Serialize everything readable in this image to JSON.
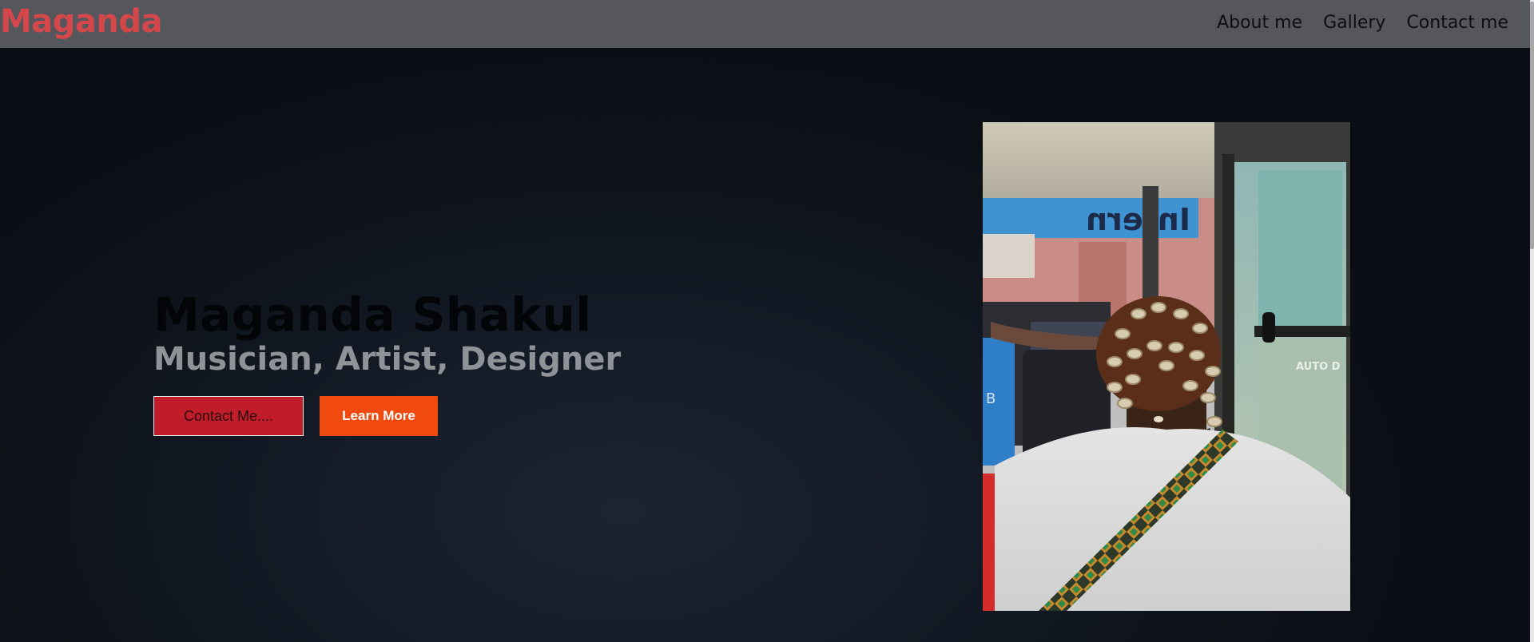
{
  "brand": {
    "name": "Maganda"
  },
  "nav": {
    "links": [
      {
        "label": "About me"
      },
      {
        "label": "Gallery"
      },
      {
        "label": "Contact me"
      }
    ]
  },
  "hero": {
    "title": "Maganda Shakul",
    "subtitle": "Musician, Artist, Designer",
    "contact_button": "Contact Me....",
    "learn_button": "Learn More",
    "photo_text": {
      "sign_left": "Intern",
      "sign_right": "AUTO D",
      "cylinder": "B"
    }
  },
  "colors": {
    "navbar": "#56575d",
    "logo": "#d4474a",
    "contact_button": "#c01c2a",
    "learn_button": "#f04a0e",
    "background": "#0f141c"
  }
}
